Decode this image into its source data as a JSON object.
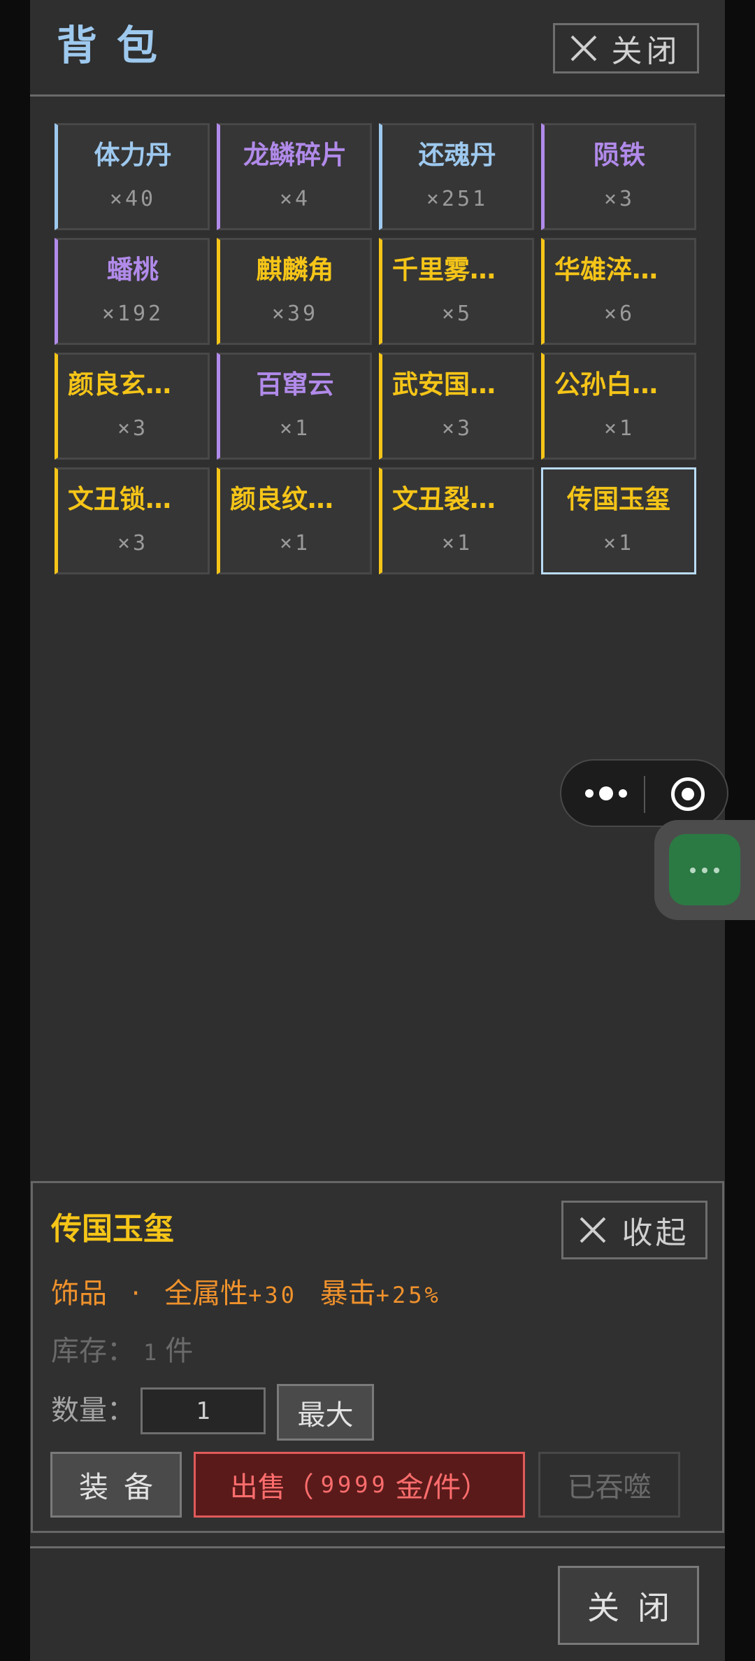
{
  "header": {
    "title": "背包",
    "close_label": "关闭"
  },
  "grid": {
    "items": [
      {
        "name": "体力丹",
        "count": "×40",
        "rarity": "blue"
      },
      {
        "name": "龙鳞碎片",
        "count": "×4",
        "rarity": "purple"
      },
      {
        "name": "还魂丹",
        "count": "×251",
        "rarity": "blue"
      },
      {
        "name": "陨铁",
        "count": "×3",
        "rarity": "purple"
      },
      {
        "name": "蟠桃",
        "count": "×192",
        "rarity": "purple"
      },
      {
        "name": "麒麟角",
        "count": "×39",
        "rarity": "gold"
      },
      {
        "name": "千里雾…",
        "count": "×5",
        "rarity": "gold"
      },
      {
        "name": "华雄淬…",
        "count": "×6",
        "rarity": "gold"
      },
      {
        "name": "颜良玄…",
        "count": "×3",
        "rarity": "gold"
      },
      {
        "name": "百窜云",
        "count": "×1",
        "rarity": "purple"
      },
      {
        "name": "武安国…",
        "count": "×3",
        "rarity": "gold"
      },
      {
        "name": "公孙白…",
        "count": "×1",
        "rarity": "gold"
      },
      {
        "name": "文丑锁…",
        "count": "×3",
        "rarity": "gold"
      },
      {
        "name": "颜良纹…",
        "count": "×1",
        "rarity": "gold"
      },
      {
        "name": "文丑裂…",
        "count": "×1",
        "rarity": "gold"
      },
      {
        "name": "传国玉玺",
        "count": "×1",
        "rarity": "gold",
        "selected": true
      }
    ]
  },
  "capsule": {
    "more_icon": "more-dots-icon",
    "close_icon": "target-circle-icon"
  },
  "float_chat": {
    "icon": "chat-bubble-icon"
  },
  "detail": {
    "name": "传国玉玺",
    "collapse_label": "收起",
    "type": "饰品",
    "separator": "·",
    "attr1_name": "全属性",
    "attr1_value": "+30",
    "attr2_name": "暴击",
    "attr2_value": "+25%",
    "stock_label": "库存：",
    "stock_value": "1",
    "stock_unit": "件",
    "qty_label": "数量：",
    "qty_value": "1",
    "max_label": "最大",
    "equip_label": "装备",
    "sell_prefix": "出售（",
    "sell_price": "9999",
    "sell_suffix": "金/件）",
    "devoured_label": "已吞噬"
  },
  "footer": {
    "close_label": "关闭"
  },
  "colors": {
    "blue": "#9ec9ef",
    "purple": "#b18aea",
    "gold": "#f5c518",
    "orange": "#f0922c",
    "sell_red": "#ff6d6d"
  }
}
